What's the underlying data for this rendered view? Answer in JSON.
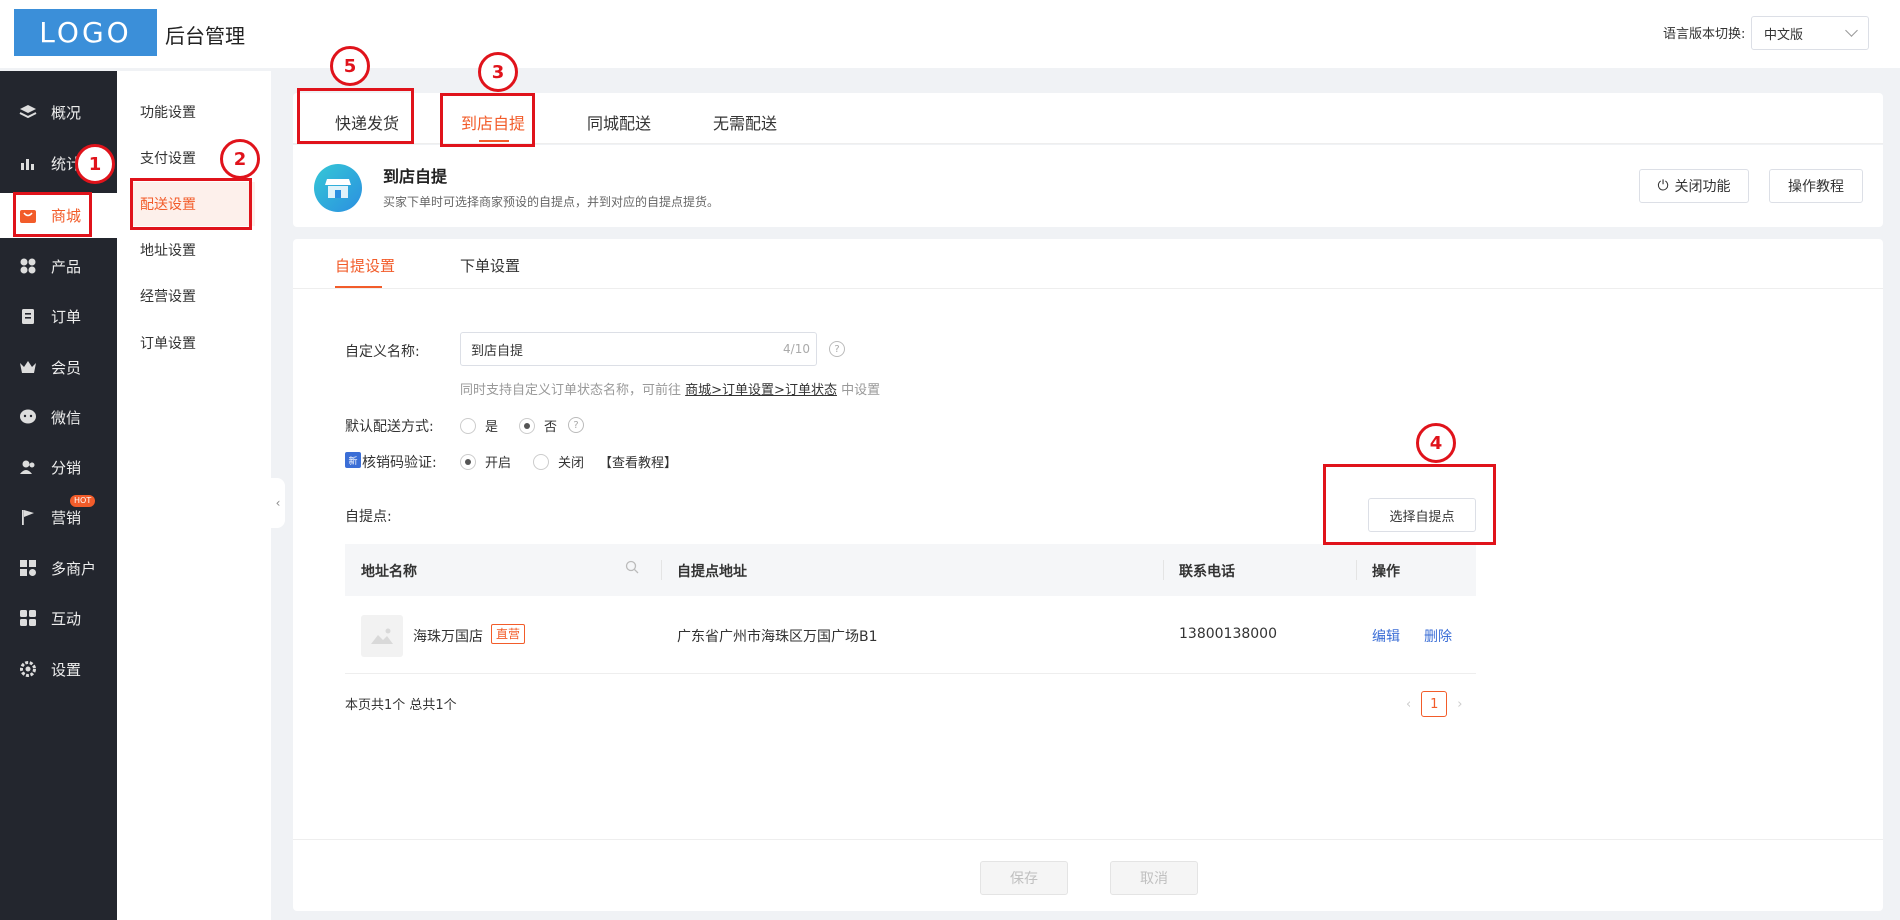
{
  "header": {
    "logo": "LOGO",
    "title": "后台管理",
    "lang_label": "语言版本切换:",
    "lang_value": "中文版"
  },
  "sidebar": {
    "items": [
      {
        "label": "概况",
        "icon": "layers-icon"
      },
      {
        "label": "统计",
        "icon": "chart-icon"
      },
      {
        "label": "商城",
        "icon": "shop-icon"
      },
      {
        "label": "产品",
        "icon": "grid-icon"
      },
      {
        "label": "订单",
        "icon": "clipboard-icon"
      },
      {
        "label": "会员",
        "icon": "crown-icon"
      },
      {
        "label": "微信",
        "icon": "wechat-icon"
      },
      {
        "label": "分销",
        "icon": "users-icon"
      },
      {
        "label": "营销",
        "icon": "flag-icon"
      },
      {
        "label": "多商户",
        "icon": "merchant-icon"
      },
      {
        "label": "互动",
        "icon": "apps-icon"
      },
      {
        "label": "设置",
        "icon": "gear-icon"
      }
    ],
    "hot_badge": "HOT",
    "active": "商城"
  },
  "subnav": {
    "items": [
      "功能设置",
      "支付设置",
      "配送设置",
      "地址设置",
      "经营设置",
      "订单设置"
    ],
    "active": "配送设置"
  },
  "delivery_tabs": [
    "快递发货",
    "到店自提",
    "同城配送",
    "无需配送"
  ],
  "active_delivery_tab": "到店自提",
  "info": {
    "title": "到店自提",
    "desc": "买家下单时可选择商家预设的自提点，并到对应的自提点提货。",
    "close_btn": "关闭功能",
    "tutorial_btn": "操作教程"
  },
  "inner_tabs": [
    "自提设置",
    "下单设置"
  ],
  "form": {
    "name_label": "自定义名称:",
    "name_value": "到店自提",
    "name_count": "4/10",
    "hint_prefix": "同时支持自定义订单状态名称，可前往",
    "hint_link": "商城>订单设置>订单状态",
    "hint_suffix": "中设置",
    "default_label": "默认配送方式:",
    "default_yes": "是",
    "default_no": "否",
    "verify_badge": "新",
    "verify_label": "核销码验证:",
    "verify_on": "开启",
    "verify_off": "关闭",
    "verify_link": "【查看教程】",
    "points_label": "自提点:",
    "choose_btn": "选择自提点",
    "help": "?"
  },
  "table": {
    "columns": [
      "地址名称",
      "自提点地址",
      "联系电话",
      "操作"
    ],
    "rows": [
      {
        "name": "海珠万国店",
        "tag": "直营",
        "address": "广东省广州市海珠区万国广场B1",
        "phone": "13800138000",
        "edit": "编辑",
        "delete": "删除"
      }
    ]
  },
  "pager": {
    "summary": "本页共1个 总共1个",
    "current": "1"
  },
  "footer": {
    "save": "保存",
    "cancel": "取消"
  },
  "annotations": [
    "1",
    "2",
    "3",
    "4",
    "5"
  ],
  "colors": {
    "accent": "#f25c2a",
    "annotation": "#e0131b",
    "sidebar": "#23262e",
    "logo": "#3b8fd9",
    "link": "#3b6ed6"
  }
}
